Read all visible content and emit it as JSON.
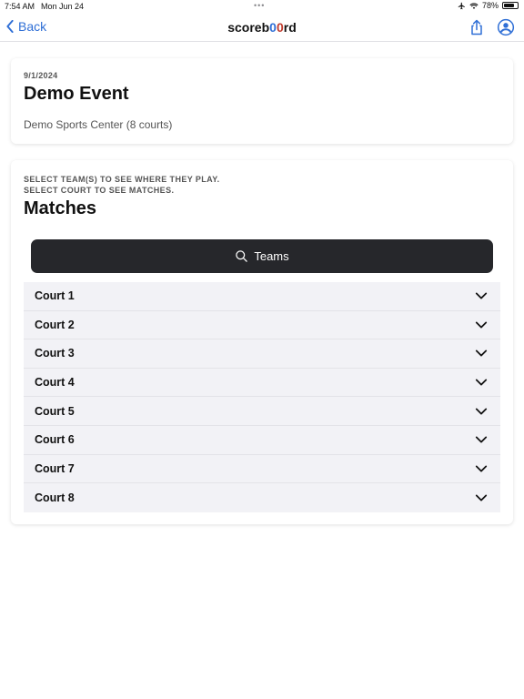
{
  "status_bar": {
    "time": "7:54 AM",
    "date": "Mon Jun 24",
    "battery": "78%",
    "battery_level": 0.78,
    "icons": [
      "airplane-icon",
      "wifi-icon",
      "battery-icon"
    ]
  },
  "nav": {
    "back_label": "Back",
    "brand_prefix": "scoreb",
    "brand_o1": "0",
    "brand_o2": "0",
    "brand_suffix": "rd",
    "icons": [
      "share-icon",
      "account-icon"
    ],
    "accent": "#2f6fd6"
  },
  "event": {
    "date": "9/1/2024",
    "title": "Demo Event",
    "venue": "Demo Sports Center (8 courts)"
  },
  "matches": {
    "instruction_line1": "SELECT TEAM(S) TO SEE WHERE THEY PLAY.",
    "instruction_line2": "SELECT COURT TO SEE MATCHES.",
    "title": "Matches",
    "teams_button_label": "Teams",
    "courts": [
      {
        "label": "Court 1"
      },
      {
        "label": "Court 2"
      },
      {
        "label": "Court 3"
      },
      {
        "label": "Court 4"
      },
      {
        "label": "Court 5"
      },
      {
        "label": "Court 6"
      },
      {
        "label": "Court 7"
      },
      {
        "label": "Court 8"
      }
    ]
  },
  "colors": {
    "teams_button_bg": "#26272b",
    "court_row_bg": "#f2f2f6"
  }
}
